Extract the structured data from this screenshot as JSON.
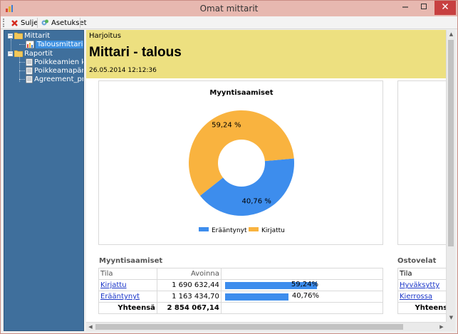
{
  "window": {
    "title": "Omat mittarit"
  },
  "toolbar": {
    "close_label": "Sulje",
    "settings_label": "Asetukset"
  },
  "tree": {
    "items": [
      {
        "label": "Mittarit",
        "type": "folder"
      },
      {
        "label": "Talousmittari",
        "type": "chart"
      },
      {
        "label": "Raportit",
        "type": "folder"
      },
      {
        "label": "Poikkeamien k",
        "type": "report"
      },
      {
        "label": "Poikkeamapär",
        "type": "report"
      },
      {
        "label": "Agreement_pro",
        "type": "report"
      }
    ]
  },
  "header": {
    "subtitle": "Harjoitus",
    "title": "Mittari - talous",
    "date": "26.05.2014 12:12:36"
  },
  "colors": {
    "eraantynyt": "#3d8ded",
    "kirjattu": "#f9b33f",
    "header_band": "#ede080"
  },
  "chart_data": {
    "type": "pie",
    "title": "Myyntisaamiset",
    "categories": [
      "Erääntynyt",
      "Kirjattu"
    ],
    "values": [
      40.76,
      59.24
    ],
    "value_labels": [
      "40,76 %",
      "59,24 %"
    ],
    "colors": [
      "#3d8ded",
      "#f9b33f"
    ],
    "donut": true,
    "legend": "bottom"
  },
  "table1": {
    "title": "Myyntisaamiset",
    "col_state": "Tila",
    "col_open": "Avoinna",
    "rows": [
      {
        "state": "Kirjattu",
        "open": "1 690 632,44",
        "pct": "59,24%",
        "ratio": 0.5924
      },
      {
        "state": "Erääntynyt",
        "open": "1 163 434,70",
        "pct": "40,76%",
        "ratio": 0.4076
      }
    ],
    "total_label": "Yhteensä",
    "total_value": "2 854 067,14"
  },
  "table2": {
    "title": "Ostovelat",
    "col_state": "Tila",
    "rows": [
      {
        "state": "Hyväksytty"
      },
      {
        "state": "Kierrossa"
      }
    ],
    "total_label": "Yhteensä"
  }
}
